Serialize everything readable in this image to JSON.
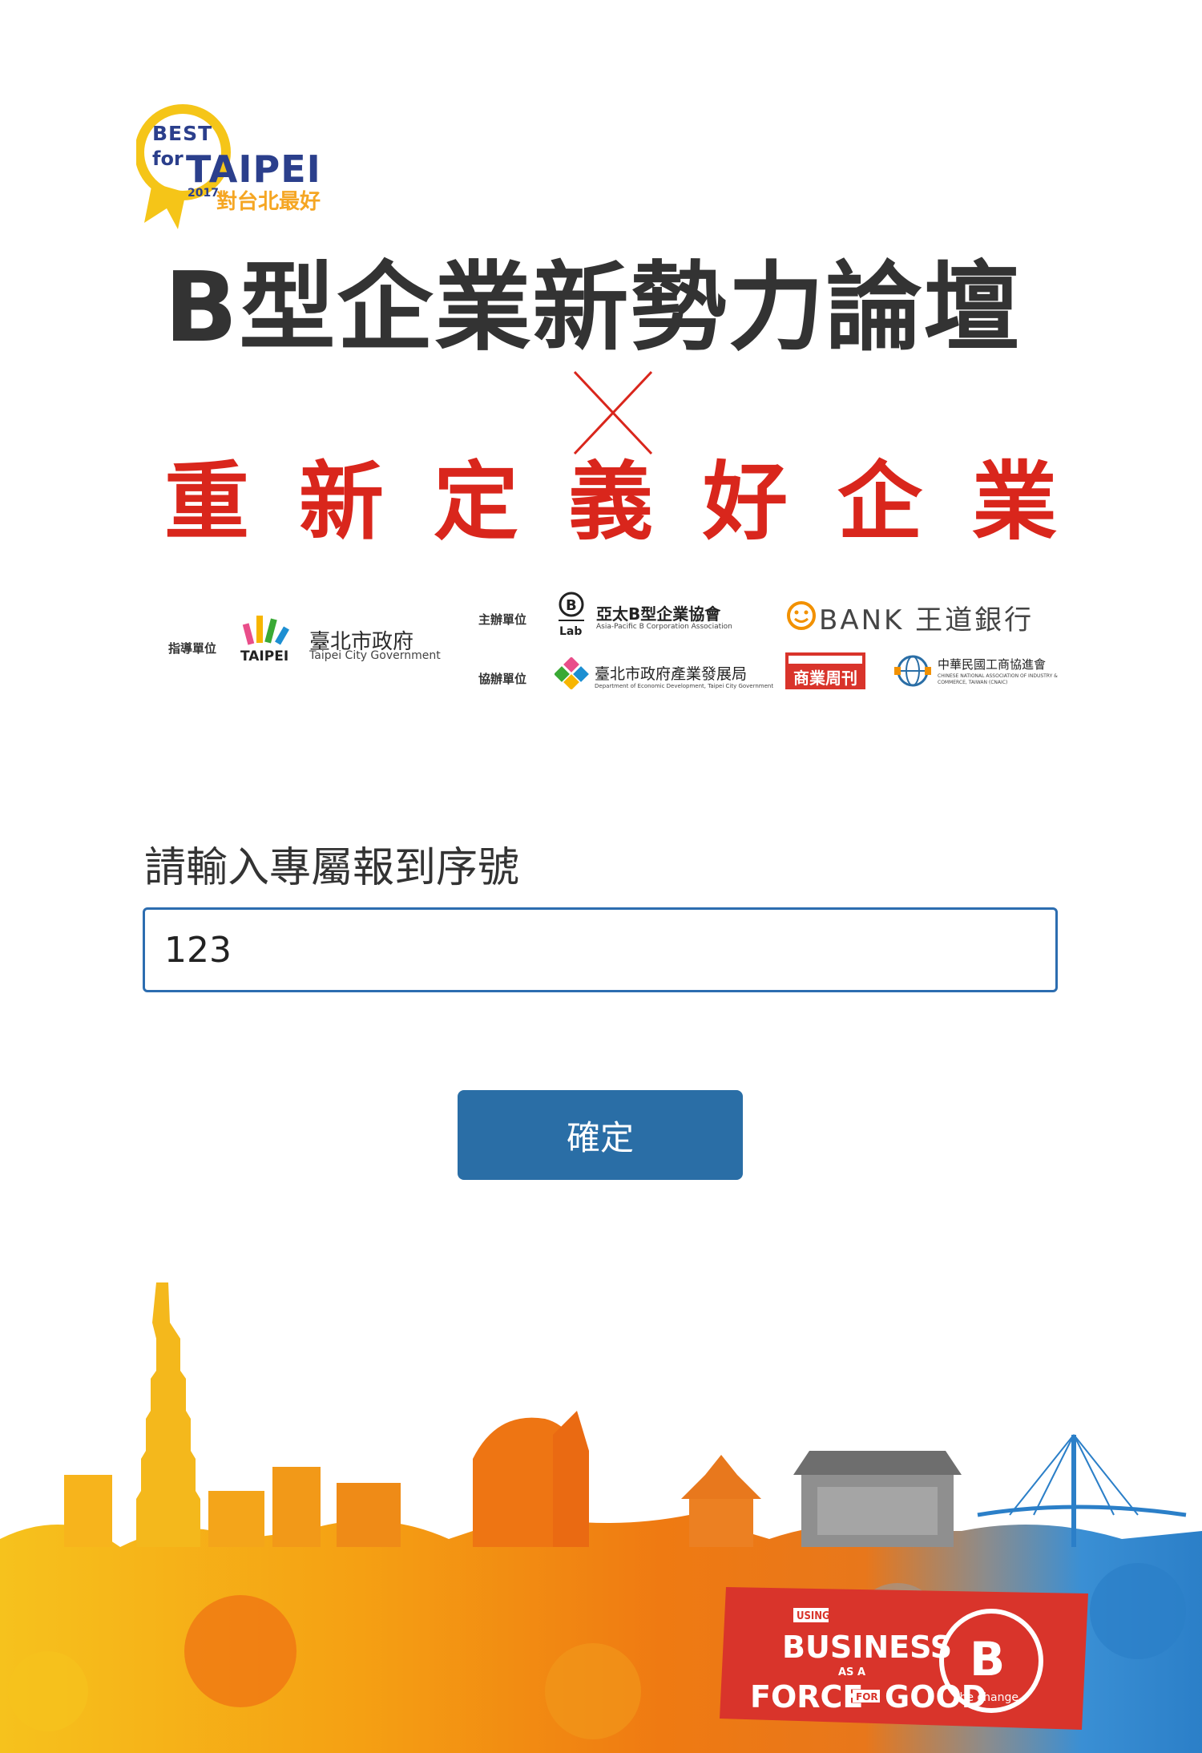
{
  "badge": {
    "best": "BEST",
    "for": "for",
    "taipei": "TAIPEI",
    "year": "2017",
    "zh": "對台北最好"
  },
  "title": {
    "main": "B型企業新勢力論壇",
    "subtitle": "重新定義好企業"
  },
  "organizers": {
    "guide_label": "指導單位",
    "host_label": "主辦單位",
    "co_label": "協辦單位",
    "taipei_logo_text": "TAIPEI",
    "taipei_zh": "臺北市政府",
    "taipei_en": "Taipei City Government",
    "blab_logo_text": "Lab",
    "blab_zh": "亞太B型企業協會",
    "blab_en": "Asia-Pacific B Corporation Association",
    "obank": "BANK 王道銀行",
    "dept_zh": "臺北市政府產業發展局",
    "dept_en": "Department of Economic Development, Taipei City Government",
    "bw_text": "商業周刊",
    "cnaic_zh": "中華民國工商協進會",
    "cnaic_en": "CHINESE NATIONAL ASSOCIATION OF INDUSTRY & COMMERCE, TAIWAN (CNAIC)"
  },
  "form": {
    "label": "請輸入專屬報到序號",
    "input_value": "123",
    "confirm_label": "確定"
  },
  "sign": {
    "using": "USING",
    "business": "BUSINESS",
    "as_a": "AS A",
    "force": "FORCE",
    "for": "FOR",
    "good": "GOOD",
    "b": "B",
    "the_change": "the change"
  },
  "colors": {
    "title": "#333333",
    "subtitle": "#d9261c",
    "input_border": "#2c6db0",
    "button": "#2a6ea6",
    "badge_blue": "#2b3f8c",
    "badge_yellow": "#f5c518",
    "sign_red": "#d9342b"
  }
}
